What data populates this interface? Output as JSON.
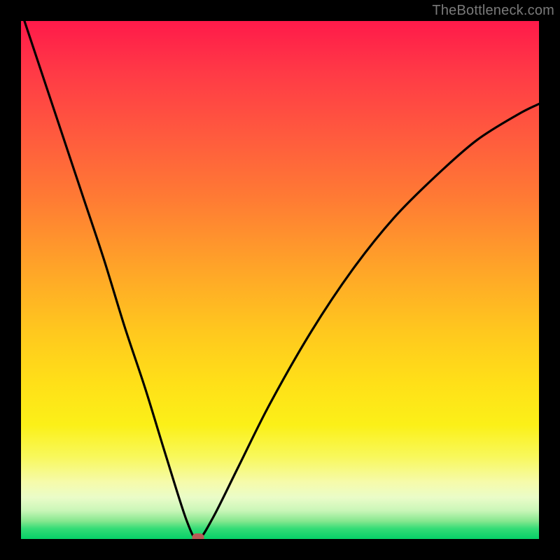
{
  "watermark": "TheBottleneck.com",
  "chart_data": {
    "type": "line",
    "title": "",
    "xlabel": "",
    "ylabel": "",
    "xlim": [
      0,
      1
    ],
    "ylim": [
      0,
      1
    ],
    "grid": false,
    "legend": false,
    "background_gradient": {
      "stops": [
        {
          "pos": 0.0,
          "color": "#ff1a4a"
        },
        {
          "pos": 0.5,
          "color": "#ffc81e"
        },
        {
          "pos": 0.85,
          "color": "#f8f85a"
        },
        {
          "pos": 1.0,
          "color": "#06d168"
        }
      ],
      "direction": "top-to-bottom"
    },
    "series": [
      {
        "name": "bottleneck-curve",
        "color": "#000000",
        "x": [
          0.0,
          0.04,
          0.08,
          0.12,
          0.16,
          0.2,
          0.24,
          0.28,
          0.32,
          0.3415,
          0.37,
          0.42,
          0.48,
          0.56,
          0.64,
          0.72,
          0.8,
          0.88,
          0.96,
          1.0
        ],
        "y": [
          1.02,
          0.9,
          0.78,
          0.66,
          0.54,
          0.41,
          0.29,
          0.16,
          0.035,
          0.0,
          0.04,
          0.14,
          0.26,
          0.4,
          0.52,
          0.62,
          0.7,
          0.77,
          0.82,
          0.84
        ]
      }
    ],
    "marker": {
      "name": "optimal-point",
      "x": 0.3415,
      "y": 0.003,
      "color": "#b85b56"
    }
  }
}
